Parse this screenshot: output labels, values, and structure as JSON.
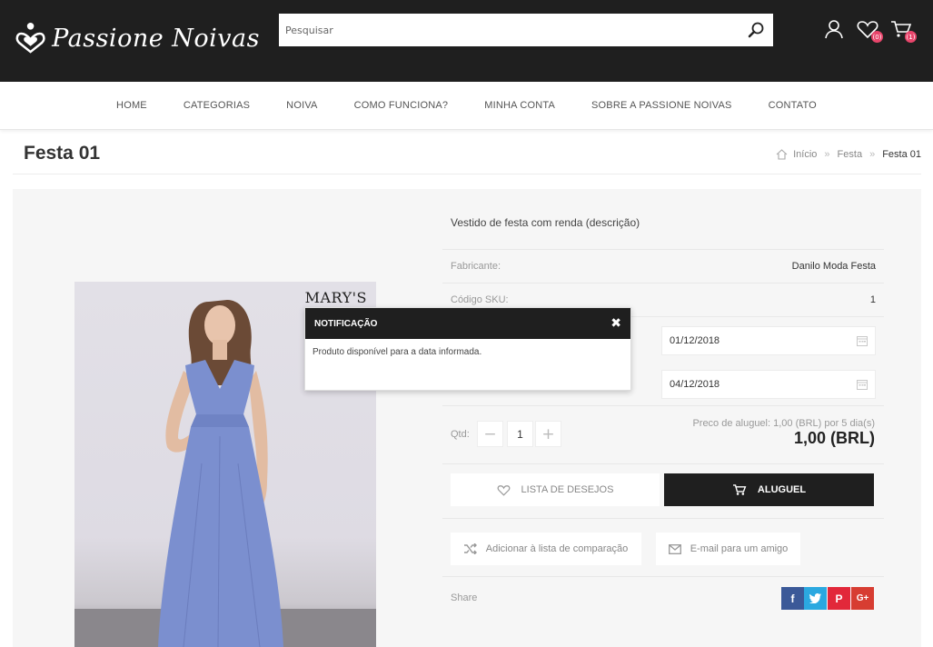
{
  "header": {
    "logo_text": "Passione Noivas",
    "search_placeholder": "Pesquisar",
    "wishlist_count": "(0)",
    "cart_count": "(1)"
  },
  "nav": {
    "items": [
      "HOME",
      "CATEGORIAS",
      "NOIVA",
      "COMO FUNCIONA?",
      "MINHA CONTA",
      "SOBRE A PASSIONE NOIVAS",
      "CONTATO"
    ]
  },
  "page": {
    "title": "Festa 01",
    "breadcrumb": [
      "Início",
      "Festa",
      "Festa 01"
    ]
  },
  "product": {
    "brand_mark": "MARY'S",
    "description": "Vestido de festa com renda (descrição)",
    "manufacturer_label": "Fabricante:",
    "manufacturer_value": "Danilo Moda Festa",
    "sku_label": "Código SKU:",
    "sku_value": "1",
    "start_date": "01/12/2018",
    "end_date": "04/12/2018",
    "qty_label": "Qtd:",
    "qty_value": "1",
    "price_note": "Preco de aluguel: 1,00 (BRL) por 5 dia(s)",
    "price": "1,00 (BRL)",
    "wishlist_label": "LISTA DE DESEJOS",
    "rent_label": "ALUGUEL",
    "compare_label": "Adicionar à lista de comparação",
    "email_label": "E-mail para um amigo",
    "share_label": "Share"
  },
  "notification": {
    "title": "NOTIFICAÇÃO",
    "message": "Produto disponível para a data informada."
  },
  "colors": {
    "header_bg": "#1f1f1f",
    "badge": "#e8456b",
    "facebook": "#3b5998",
    "twitter": "#2ba8e0",
    "pinterest": "#e2283a",
    "google_plus": "#d73d32",
    "dress": "#7b8fcf"
  }
}
